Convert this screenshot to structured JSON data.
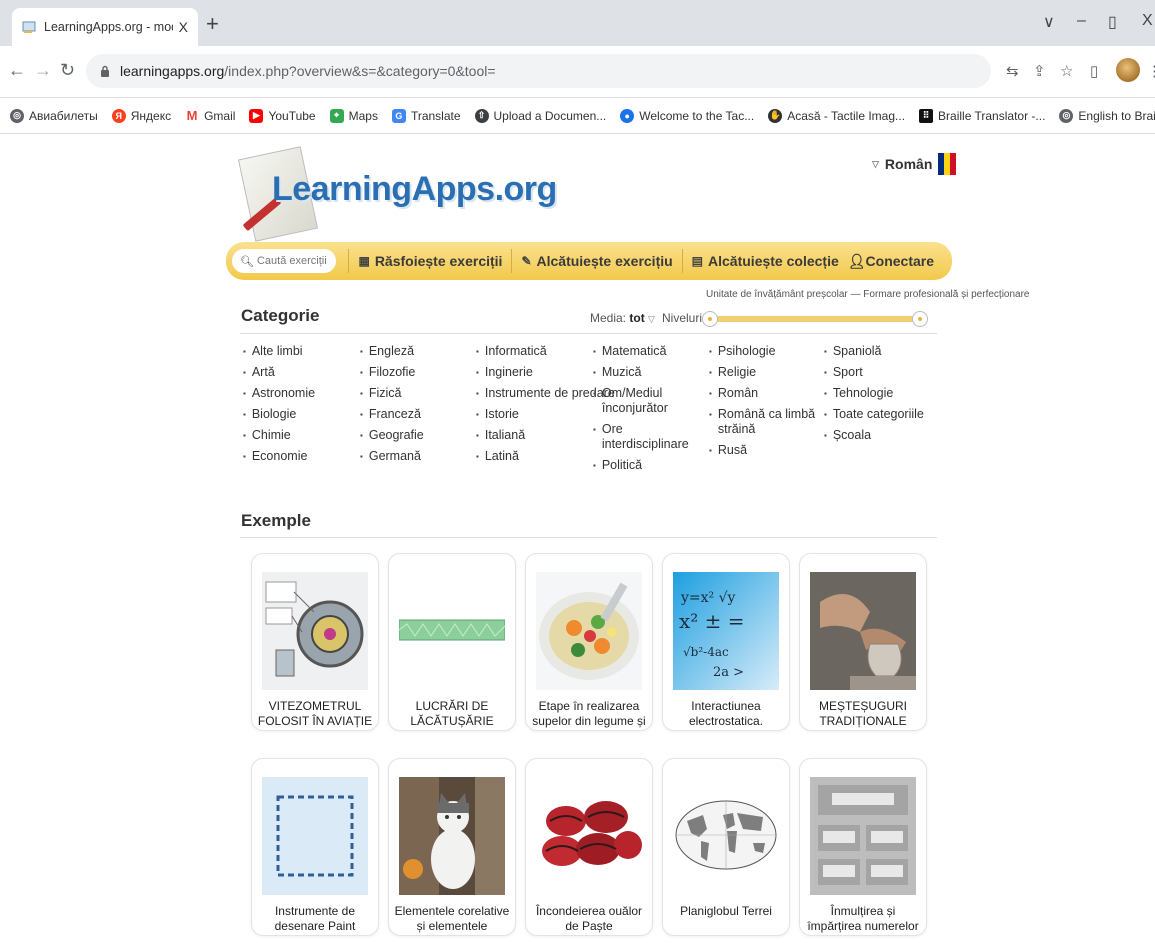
{
  "browser": {
    "tab_title": "LearningApps.org - module de în",
    "tab_close": "X",
    "new_tab": "+",
    "url_domain": "learningapps.org",
    "url_path": "/index.php?overview&s=&category=0&tool=",
    "window_controls": [
      "∨",
      "–",
      "▯",
      "X"
    ],
    "bookmarks": [
      {
        "label": "Авиабилеты",
        "icon": "globe-icon",
        "color": "#5f6368"
      },
      {
        "label": "Яндекс",
        "icon": "yandex-icon",
        "color": "#fc3f1d"
      },
      {
        "label": "Gmail",
        "icon": "gmail-icon",
        "color": "#ea4335"
      },
      {
        "label": "YouTube",
        "icon": "youtube-icon",
        "color": "#ff0000"
      },
      {
        "label": "Maps",
        "icon": "maps-icon",
        "color": "#34a853"
      },
      {
        "label": "Translate",
        "icon": "translate-icon",
        "color": "#4285f4"
      },
      {
        "label": "Upload a Documen...",
        "icon": "upload-icon",
        "color": "#3c4043"
      },
      {
        "label": "Welcome to the Tac...",
        "icon": "tactile-icon",
        "color": "#1a73e8"
      },
      {
        "label": "Acasă - Tactile Imag...",
        "icon": "tactile-image-icon",
        "color": "#333"
      },
      {
        "label": "Braille Translator -...",
        "icon": "braille-icon",
        "color": "#111"
      },
      {
        "label": "English to Braille Tr...",
        "icon": "globe-icon",
        "color": "#5f6368"
      }
    ]
  },
  "site": {
    "logo_text": "LearningApps.org",
    "language": "Român",
    "flag_colors": [
      "#002b7f",
      "#fcd116",
      "#ce1126"
    ]
  },
  "menu": {
    "search_placeholder": "Caută exerciții",
    "browse": "Răsfoiește exerciții",
    "create_exercise": "Alcătuiește exercițiu",
    "create_collection": "Alcătuiește colecție",
    "connect": "Conectare"
  },
  "filters": {
    "heading": "Categorie",
    "media_label": "Media:",
    "media_value": "tot",
    "levels_label": "Niveluri:",
    "levels_caption": "Unitate de învățământ preșcolar — Formare profesională și perfecționare"
  },
  "categories": [
    [
      "Alte limbi",
      "Artă",
      "Astronomie",
      "Biologie",
      "Chimie",
      "Economie"
    ],
    [
      "Engleză",
      "Filozofie",
      "Fizică",
      "Franceză",
      "Geografie",
      "Germană"
    ],
    [
      "Informatică",
      "Inginerie",
      "Instrumente de predare",
      "Istorie",
      "Italiană",
      "Latină"
    ],
    [
      "Matematică",
      "Muzică",
      "Om/Mediul înconjurător",
      "Ore interdisciplinare",
      "Politică"
    ],
    [
      "Psihologie",
      "Religie",
      "Român",
      "Română ca limbă străină",
      "Rusă"
    ],
    [
      "Spaniolă",
      "Sport",
      "Tehnologie",
      "Toate categoriile",
      "Școala"
    ]
  ],
  "examples": {
    "heading": "Exemple",
    "cards": [
      {
        "title": "VITEZOMETRUL FOLOSIT ÎN AVIAȚIE",
        "thumb": "engine-diagram"
      },
      {
        "title": "LUCRĂRI DE LĂCĂTUȘĂRIE",
        "thumb": "green-strip"
      },
      {
        "title": "Etape în realizarea supelor din legume și",
        "thumb": "vegetable-soup"
      },
      {
        "title": "Interactiunea electrostatica.",
        "thumb": "math-formulas"
      },
      {
        "title": "MEȘTEȘUGURI TRADIȚIONALE",
        "thumb": "pottery"
      },
      {
        "title": "Instrumente de desenare Paint",
        "thumb": "dashed-selection"
      },
      {
        "title": "Elementele corelative și elementele",
        "thumb": "cat-photo"
      },
      {
        "title": "Încondeierea ouălor de Paște",
        "thumb": "painted-eggs"
      },
      {
        "title": "Planiglobul Terrei",
        "thumb": "world-map"
      },
      {
        "title": "Înmulțirea și împărțirea numerelor",
        "thumb": "grey-form"
      }
    ]
  }
}
